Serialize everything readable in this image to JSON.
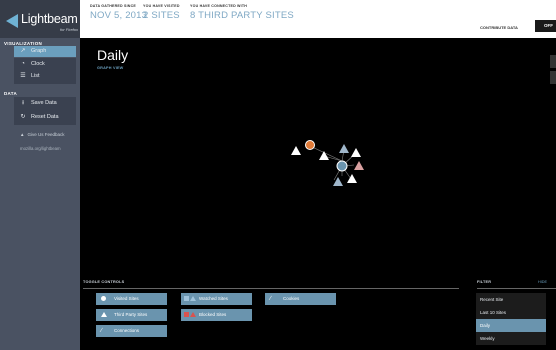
{
  "app": {
    "title": "Lightbeam",
    "subtitle": "for Firefox"
  },
  "sidebar": {
    "visualization_heading": "VISUALIZATION",
    "views": [
      {
        "label": "Graph",
        "icon": "graph-icon",
        "active": true
      },
      {
        "label": "Clock",
        "icon": "clock-icon",
        "active": false
      },
      {
        "label": "List",
        "icon": "list-icon",
        "active": false
      }
    ],
    "data_heading": "DATA",
    "data_items": [
      {
        "label": "Save Data",
        "icon": "save-icon"
      },
      {
        "label": "Reset Data",
        "icon": "reset-icon"
      }
    ],
    "feedback": "Give Us Feedback",
    "mozilla_link": "mozilla.org/lightbeam"
  },
  "header": {
    "stats": [
      {
        "label": "DATA GATHERED SINCE",
        "value": "NOV 5, 2013"
      },
      {
        "label": "YOU HAVE VISITED",
        "value": "2 SITES"
      },
      {
        "label": "YOU HAVE CONNECTED WITH",
        "value": "8 THIRD PARTY SITES"
      }
    ],
    "contribute_label": "CONTRIBUTE DATA",
    "contribute_state": "OFF"
  },
  "main": {
    "title": "Daily",
    "subtitle": "GRAPH VIEW"
  },
  "toggle_controls": {
    "heading": "TOGGLE CONTROLS",
    "buttons": [
      {
        "label": "Visited Sites",
        "icon": "visited-dot-icon"
      },
      {
        "label": "Watched Sites",
        "icon": "watched-icon"
      },
      {
        "label": "Cookies",
        "icon": "cookie-icon"
      },
      {
        "label": "Third Party Sites",
        "icon": "triangle-icon"
      },
      {
        "label": "Blocked Sites",
        "icon": "blocked-icon"
      },
      {
        "label": "Connections",
        "icon": "connection-line-icon"
      }
    ]
  },
  "filter": {
    "heading": "FILTER",
    "hide_label": "HIDE",
    "options": [
      "Recent Site",
      "Last 10 Sites",
      "Daily",
      "Weekly"
    ],
    "selected": "Daily"
  },
  "colors": {
    "accent": "#6b9fbe",
    "button": "#6a94ae",
    "sidebar": "#4a5262",
    "header_value": "#7fa8c4",
    "visited_node": "#e07b39",
    "blocked": "#d9534f"
  }
}
